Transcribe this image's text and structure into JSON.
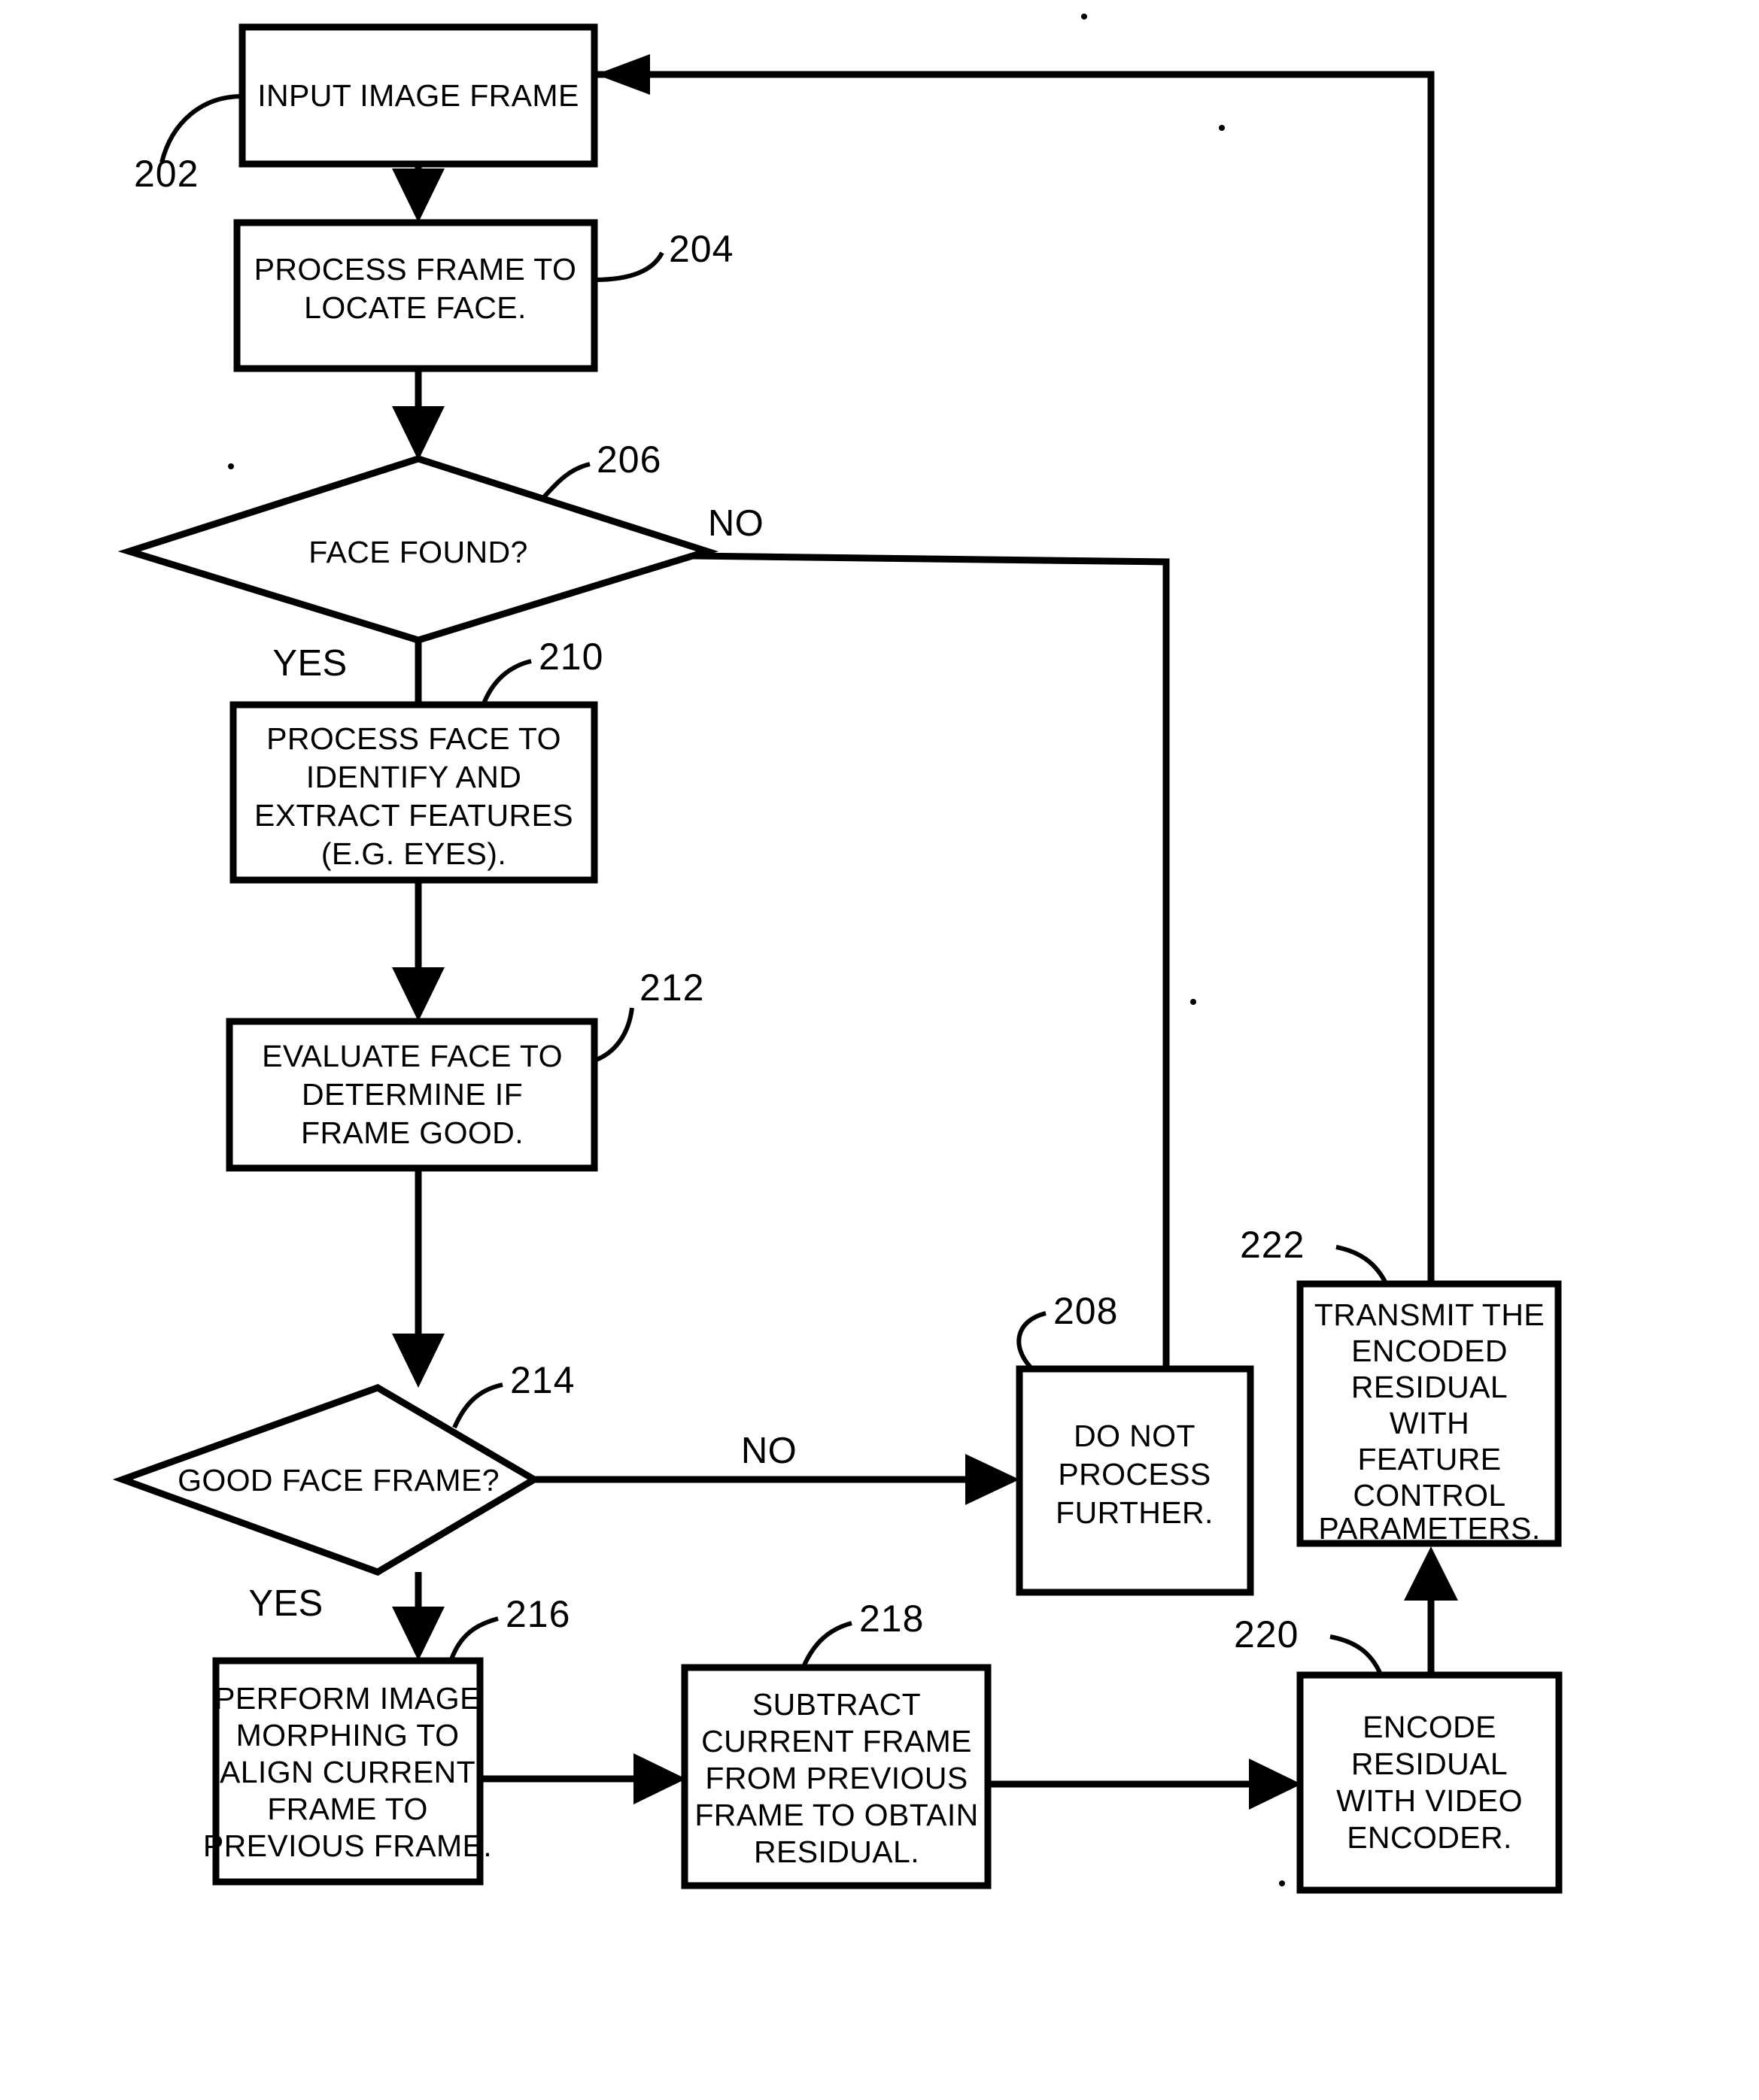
{
  "figure": {
    "type": "flowchart",
    "title": "",
    "background_color": "#ffffff",
    "line_color": "#000000"
  },
  "nodes": {
    "n202": {
      "ref": "202",
      "shape": "process",
      "lines": [
        "INPUT IMAGE FRAME"
      ]
    },
    "n204": {
      "ref": "204",
      "shape": "process",
      "lines": [
        "PROCESS FRAME TO",
        "LOCATE FACE."
      ]
    },
    "n206": {
      "ref": "206",
      "shape": "decision",
      "lines": [
        "FACE FOUND?"
      ]
    },
    "n208": {
      "ref": "208",
      "shape": "process",
      "lines": [
        "DO NOT",
        "PROCESS",
        "FURTHER."
      ]
    },
    "n210": {
      "ref": "210",
      "shape": "process",
      "lines": [
        "PROCESS FACE TO",
        "IDENTIFY AND",
        "EXTRACT FEATURES",
        "(E.G. EYES)."
      ]
    },
    "n212": {
      "ref": "212",
      "shape": "process",
      "lines": [
        "EVALUATE FACE TO",
        "DETERMINE IF",
        "FRAME GOOD."
      ]
    },
    "n214": {
      "ref": "214",
      "shape": "decision",
      "lines": [
        "GOOD FACE FRAME?"
      ]
    },
    "n216": {
      "ref": "216",
      "shape": "process",
      "lines": [
        "PERFORM IMAGE",
        "MORPHING TO",
        "ALIGN CURRENT",
        "FRAME TO",
        "PREVIOUS FRAME."
      ]
    },
    "n218": {
      "ref": "218",
      "shape": "process",
      "lines": [
        "SUBTRACT",
        "CURRENT FRAME",
        "FROM PREVIOUS",
        "FRAME TO OBTAIN",
        "RESIDUAL."
      ]
    },
    "n220": {
      "ref": "220",
      "shape": "process",
      "lines": [
        "ENCODE",
        "RESIDUAL",
        "WITH VIDEO",
        "ENCODER."
      ]
    },
    "n222": {
      "ref": "222",
      "shape": "process",
      "lines": [
        "TRANSMIT THE",
        "ENCODED",
        "RESIDUAL",
        "WITH",
        "FEATURE",
        "CONTROL",
        "PARAMETERS."
      ]
    }
  },
  "branch_labels": {
    "yes_206": "YES",
    "no_206": "NO",
    "yes_214": "YES",
    "no_214": "NO"
  },
  "edges": [
    {
      "from": "202",
      "to": "204",
      "label": ""
    },
    {
      "from": "204",
      "to": "206",
      "label": ""
    },
    {
      "from": "206",
      "to": "210",
      "label": "YES"
    },
    {
      "from": "206",
      "to": "208",
      "label": "NO"
    },
    {
      "from": "210",
      "to": "212",
      "label": ""
    },
    {
      "from": "212",
      "to": "214",
      "label": ""
    },
    {
      "from": "214",
      "to": "216",
      "label": "YES"
    },
    {
      "from": "214",
      "to": "208",
      "label": "NO"
    },
    {
      "from": "216",
      "to": "218",
      "label": ""
    },
    {
      "from": "218",
      "to": "220",
      "label": ""
    },
    {
      "from": "220",
      "to": "222",
      "label": ""
    },
    {
      "from": "222",
      "to": "202",
      "label": ""
    }
  ]
}
